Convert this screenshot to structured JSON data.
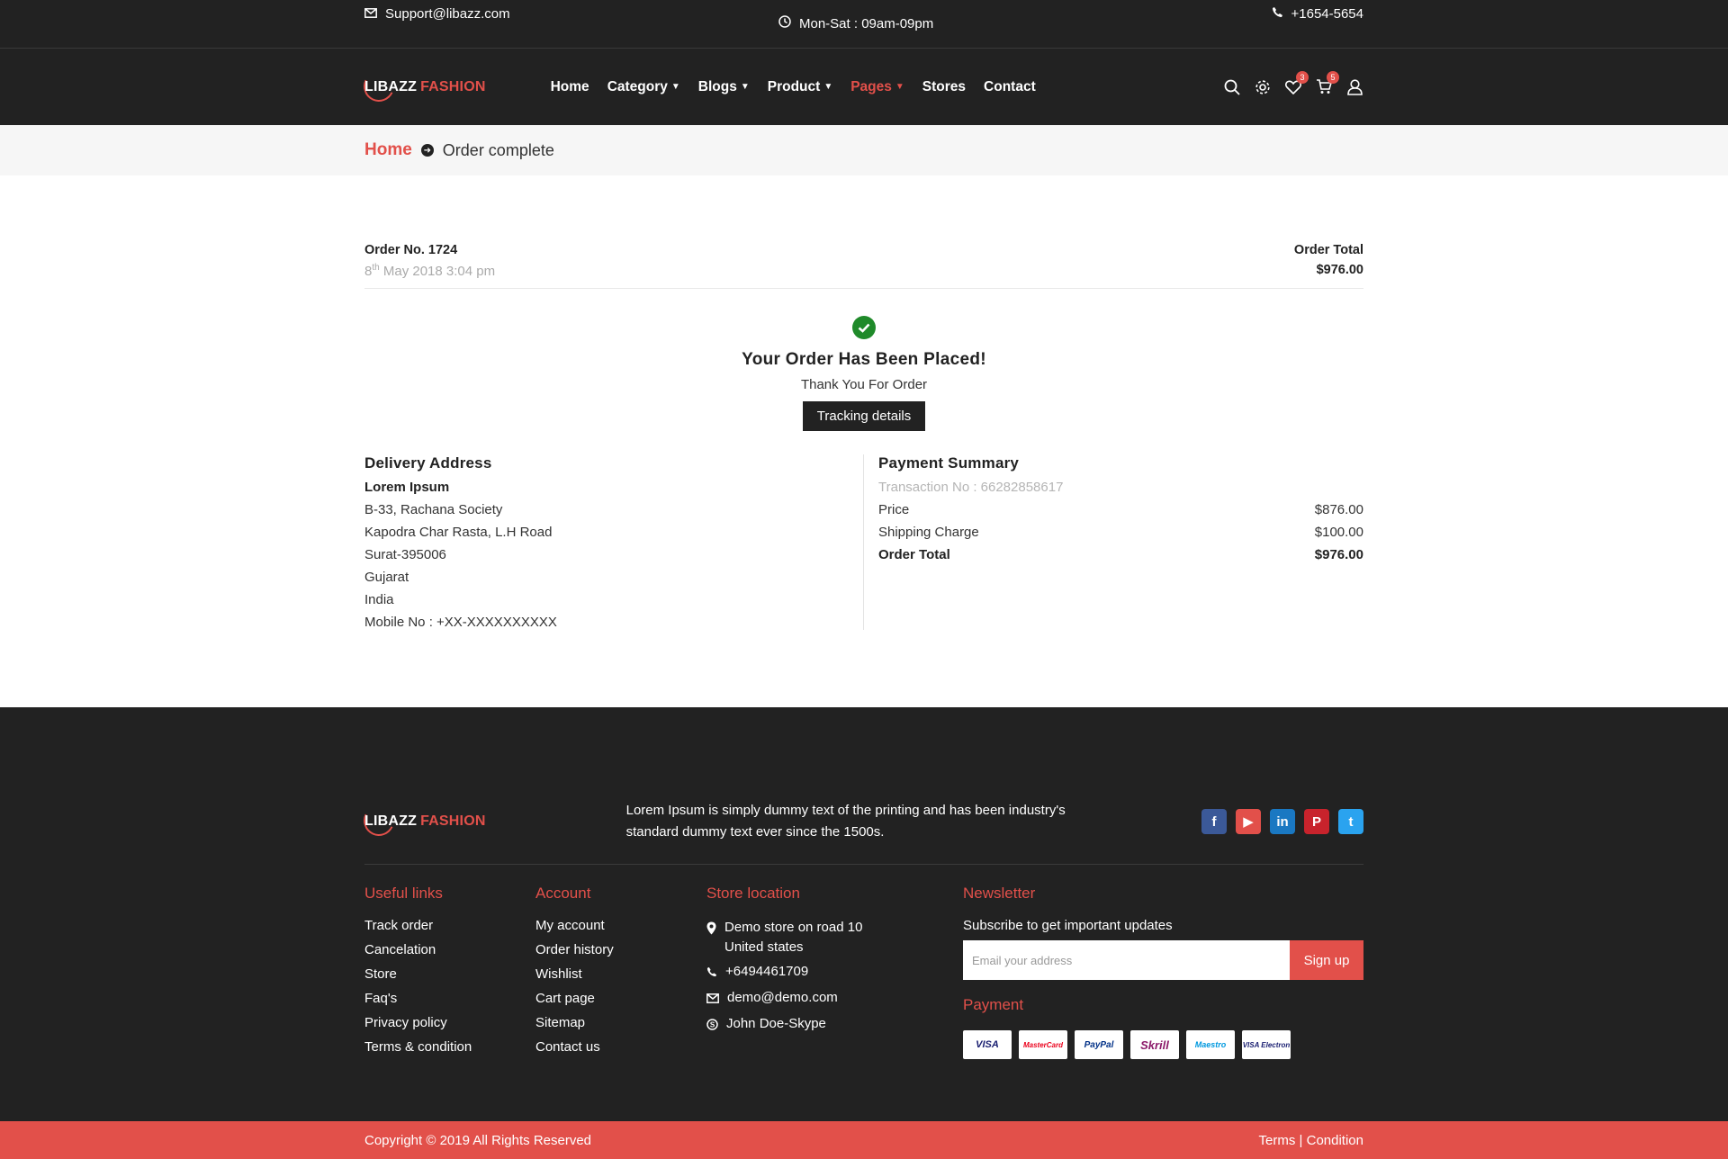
{
  "topbar": {
    "email": "Support@libazz.com",
    "hours": "Mon-Sat : 09am-09pm",
    "phone": "+1654-5654"
  },
  "brand": {
    "name_white": "LIBAZZ",
    "name_red": "FASHION",
    "accent": "#e2504a"
  },
  "nav": {
    "home": "Home",
    "category": "Category",
    "blogs": "Blogs",
    "product": "Product",
    "pages": "Pages",
    "stores": "Stores",
    "contact": "Contact"
  },
  "header_icons": {
    "wishlist_count": "3",
    "cart_count": "5"
  },
  "breadcrumb": {
    "home": "Home",
    "current": "Order complete"
  },
  "order": {
    "number": "Order No. 1724",
    "date_day": "8",
    "date_suffix": "th",
    "date_rest": " May 2018 3:04 pm",
    "total_label": "Order Total",
    "total_value": "$976.00",
    "placed_title": "Your Order Has Been Placed!",
    "thanks": "Thank You For Order",
    "tracking_button": "Tracking details"
  },
  "delivery": {
    "title": "Delivery Address",
    "name": "Lorem Ipsum",
    "lines": [
      "B-33, Rachana Society",
      "Kapodra Char Rasta, L.H Road",
      "Surat-395006",
      "Gujarat",
      "India",
      "Mobile No : +XX-XXXXXXXXXX"
    ]
  },
  "payment_summary": {
    "title": "Payment Summary",
    "transaction": "Transaction No : 66282858617",
    "rows": [
      {
        "label": "Price",
        "value": "$876.00"
      },
      {
        "label": "Shipping Charge",
        "value": "$100.00"
      },
      {
        "label": "Order Total",
        "value": "$976.00"
      }
    ]
  },
  "footer": {
    "description": "Lorem Ipsum is simply dummy text of the printing and has been industry's standard dummy text ever since the 1500s.",
    "socials": [
      "facebook-icon",
      "youtube-icon",
      "linkedin-icon",
      "pinterest-icon",
      "twitter-icon"
    ],
    "useful_links": {
      "title": "Useful links",
      "items": [
        "Track order",
        "Cancelation",
        "Store",
        "Faq's",
        "Privacy policy",
        "Terms & condition"
      ]
    },
    "account": {
      "title": "Account",
      "items": [
        "My account",
        "Order history",
        "Wishlist",
        "Cart page",
        "Sitemap",
        "Contact us"
      ]
    },
    "store": {
      "title": "Store location",
      "address_1": "Demo store on road 10",
      "address_2": "United states",
      "phone": "+6494461709",
      "email": "demo@demo.com",
      "skype": "John Doe-Skype"
    },
    "newsletter": {
      "title": "Newsletter",
      "subtitle": "Subscribe to get important updates",
      "placeholder": "Email your address",
      "button": "Sign up"
    },
    "payment": {
      "title": "Payment",
      "cards": [
        "VISA",
        "MasterCard",
        "PayPal",
        "Skrill",
        "Maestro",
        "VISA Electron"
      ]
    }
  },
  "bottombar": {
    "copyright": "Copyright © 2019 All Rights Reserved",
    "terms": "Terms",
    "sep": "|",
    "condition": "Condition"
  }
}
